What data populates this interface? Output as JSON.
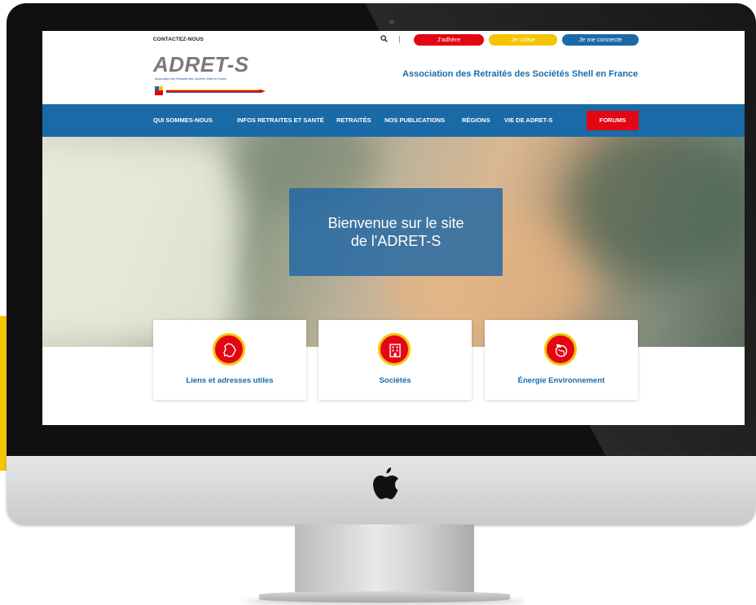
{
  "topbar": {
    "contact": "CONTACTEZ-NOUS",
    "buttons": {
      "adhere": "J'adhère",
      "cotise": "Je cotise",
      "connecte": "Je me connecte"
    }
  },
  "header": {
    "logo_title": "ADRET-S",
    "logo_subtitle": "Association des Retraités des Sociétés Shell en France",
    "association_title": "Association des Retraités des Sociétés Shell en France"
  },
  "nav": {
    "items": [
      "QUI SOMMES-NOUS",
      "INFOS RETRAITES ET SANTÉ",
      "RETRAITÉS",
      "NOS PUBLICATIONS",
      "RÉGIONS",
      "VIE DE ADRET-S"
    ],
    "forums": "FORUMS"
  },
  "hero": {
    "line1": "Bienvenue sur le site",
    "line2": "de l'ADRET-S"
  },
  "cards": [
    {
      "label": "Liens et adresses utiles",
      "icon": "france-map-icon"
    },
    {
      "label": "Sociétés",
      "icon": "building-icon"
    },
    {
      "label": "Énergie Environnement",
      "icon": "globe-plant-icon"
    }
  ],
  "colors": {
    "brand_blue": "#1a6aa8",
    "brand_red": "#e30613",
    "brand_yellow": "#f5c400"
  }
}
